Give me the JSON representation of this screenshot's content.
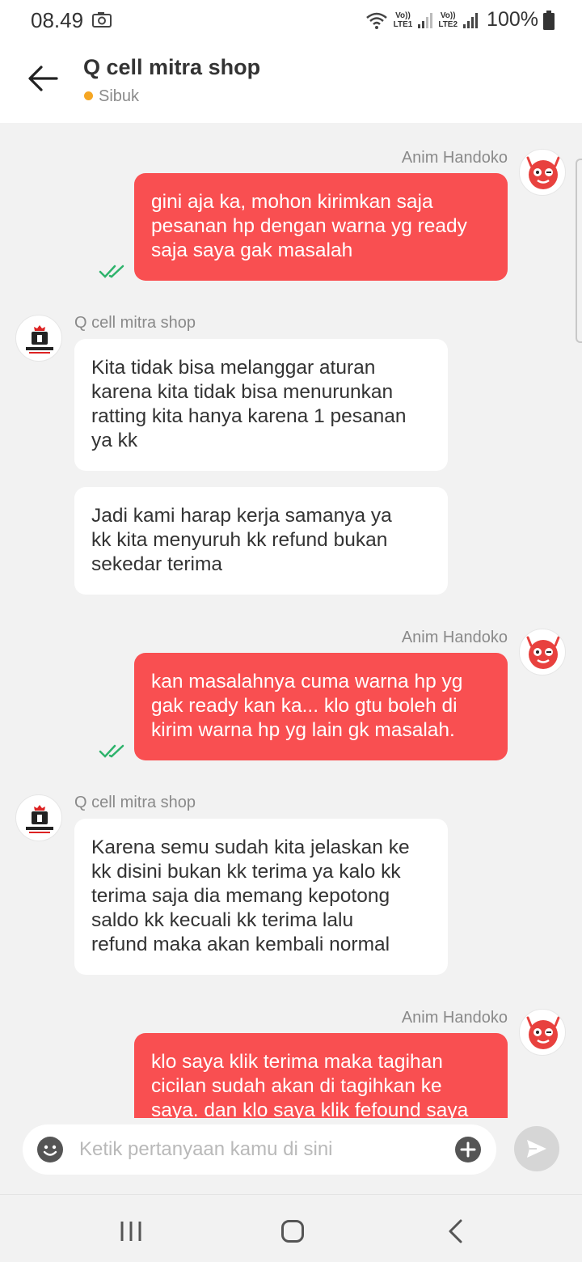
{
  "status_bar": {
    "time": "08.49",
    "sim1_top": "Vo))",
    "sim1_bottom": "LTE1",
    "sim2_top": "Vo))",
    "sim2_bottom": "LTE2",
    "battery": "100%"
  },
  "header": {
    "title": "Q cell mitra shop",
    "status": "Sibuk",
    "status_color": "#f5a623"
  },
  "colors": {
    "outgoing_bubble": "#f94f51",
    "incoming_bubble": "#ffffff",
    "read_check": "#2db36b"
  },
  "messages": [
    {
      "sender": "Anim Handoko",
      "direction": "out",
      "read": true,
      "lines": [
        "gini aja ka, mohon kirimkan saja",
        "pesanan hp dengan warna yg ready",
        "saja saya gak masalah"
      ]
    },
    {
      "sender": "Q cell mitra shop",
      "direction": "in",
      "lines": [
        "Kita tidak bisa melanggar aturan",
        "karena kita tidak bisa menurunkan",
        "ratting kita hanya karena 1 pesanan",
        "ya kk"
      ]
    },
    {
      "sender": "",
      "direction": "in",
      "lines": [
        "Jadi kami harap kerja samanya ya",
        "kk kita menyuruh kk refund bukan",
        "sekedar terima"
      ]
    },
    {
      "sender": "Anim Handoko",
      "direction": "out",
      "read": true,
      "lines": [
        "kan masalahnya cuma warna hp yg",
        "gak ready kan ka... klo gtu boleh di",
        "kirim warna hp yg lain gk masalah."
      ]
    },
    {
      "sender": "Q cell mitra shop",
      "direction": "in",
      "lines": [
        "Karena semu sudah kita jelaskan ke",
        "kk disini bukan kk terima ya kalo kk",
        "terima saja dia memang kepotong",
        "saldo kk kecuali kk terima lalu",
        "refund maka akan kembali normal"
      ]
    },
    {
      "sender": "Anim Handoko",
      "direction": "out",
      "read": false,
      "lines": [
        "klo saya klik terima maka tagihan",
        "cicilan sudah akan di tagihkan ke",
        "saya. dan klo saya klik fefound saya"
      ]
    }
  ],
  "input": {
    "placeholder": "Ketik pertanyaan kamu di sini",
    "value": ""
  },
  "icons": {
    "back": "arrow-left-icon",
    "emoji": "emoji-icon",
    "attach": "plus-circle-icon",
    "send": "send-icon",
    "nav_recents": "recents-icon",
    "nav_home": "home-icon",
    "nav_back": "chevron-left-icon"
  }
}
